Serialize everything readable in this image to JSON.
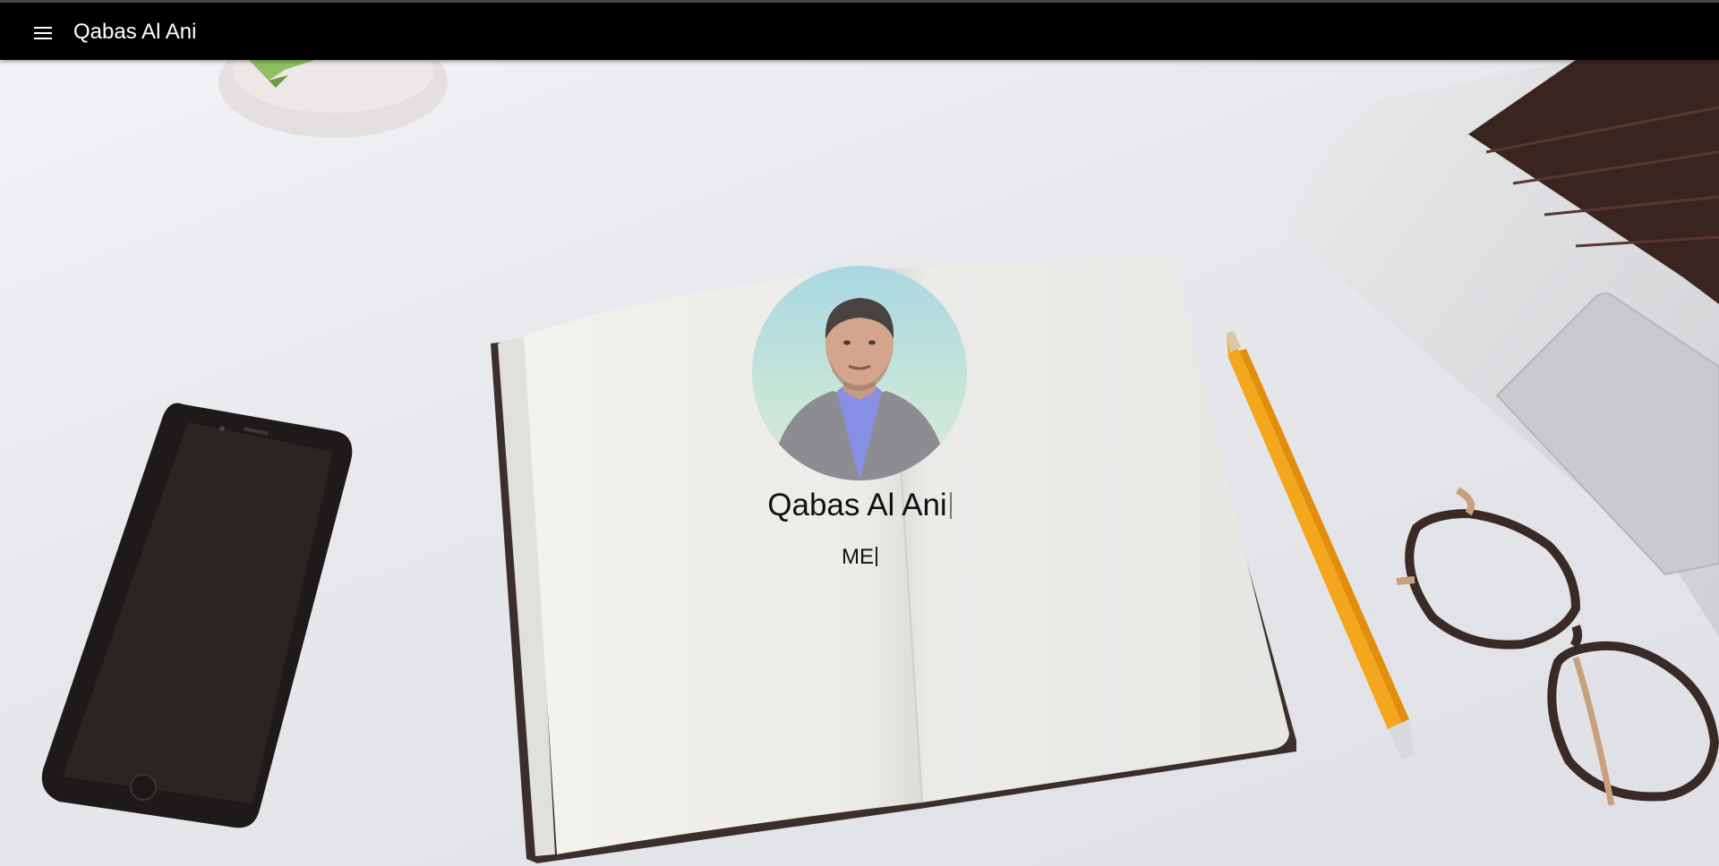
{
  "appbar": {
    "title": "Qabas Al Ani",
    "menu_icon": "hamburger-menu-icon"
  },
  "hero": {
    "name": "Qabas Al Ani",
    "subtitle": "ME"
  },
  "colors": {
    "appbar_bg": "#000000",
    "appbar_text": "#ffffff",
    "pencil": "#f4a71c"
  }
}
